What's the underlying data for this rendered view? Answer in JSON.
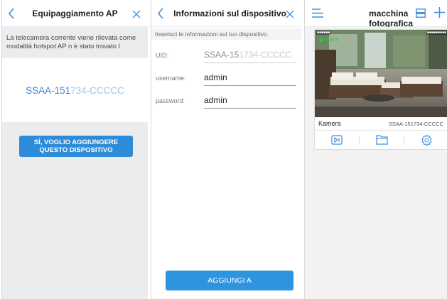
{
  "panel1": {
    "title": "Equipaggiamento AP",
    "description": "La telecamera corrente viene rilevata come modalità hotspot AP n è stato trovato l",
    "uid_prefix": "SSAA-151",
    "uid_blurred": "734-CCCCC",
    "confirm_button": "SÌ, VOGLIO AGGIUNGERE QUESTO DISPOSITIVO"
  },
  "panel2": {
    "title": "Informazioni sul dispositivo",
    "instruction": "Inserisci le informazioni sul tuo dispositivo",
    "uid_label": "UID:",
    "uid_prefix": "SSAA-15",
    "uid_blurred": "1734-CCCCC",
    "username_label": "username:",
    "username_value": "admin",
    "password_label": "password:",
    "password_value": "admin",
    "add_button": "AGGIUNGI A"
  },
  "panel3": {
    "title": "macchina fotografica",
    "card": {
      "status": "Online",
      "name": "Kamera",
      "uid": "SSAA-151734-CCCCC"
    }
  },
  "colors": {
    "accent": "#2e8bd8",
    "uid_blue": "#3a86d6",
    "online_green": "#2ecc40"
  },
  "icons": [
    "back-icon",
    "close-icon",
    "menu-icon",
    "grid-icon",
    "plus-icon",
    "playback-icon",
    "folder-icon",
    "settings-icon"
  ]
}
